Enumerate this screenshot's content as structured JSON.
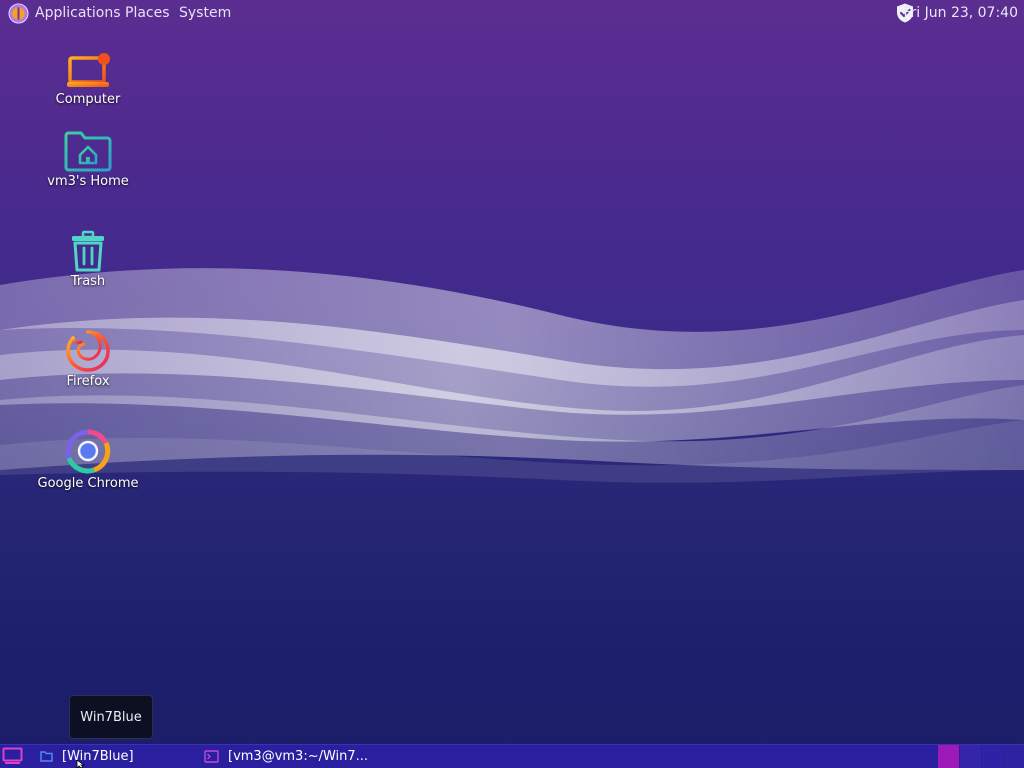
{
  "top_panel": {
    "menus": [
      "Applications",
      "Places",
      "System"
    ],
    "clock": "Fri Jun 23, 07:40",
    "icons": {
      "logo": "distro-logo-icon",
      "tray": "shield-check-icon"
    }
  },
  "desktop_icons": [
    {
      "label": "Computer",
      "icon": "computer-icon"
    },
    {
      "label": "vm3's Home",
      "icon": "home-folder-icon"
    },
    {
      "label": "Trash",
      "icon": "trash-icon"
    },
    {
      "label": "Firefox",
      "icon": "firefox-icon"
    },
    {
      "label": "Google Chrome",
      "icon": "chrome-icon"
    }
  ],
  "tooltip": {
    "text": "Win7Blue"
  },
  "taskbar": {
    "tasks": [
      {
        "label": "[Win7Blue]",
        "icon": "folder-icon",
        "minimized": true
      },
      {
        "label": "[vm3@vm3:~/Win7...",
        "icon": "terminal-icon",
        "minimized": false
      }
    ],
    "workspaces": 4,
    "active_workspace": 1
  },
  "colors": {
    "panel_text": "#e9e2f5",
    "taskbar_bg": "#2a1f9e",
    "active_workspace": "#9d1ab8",
    "accent_orange": "#f38b1c",
    "accent_teal": "#34c3b0"
  }
}
